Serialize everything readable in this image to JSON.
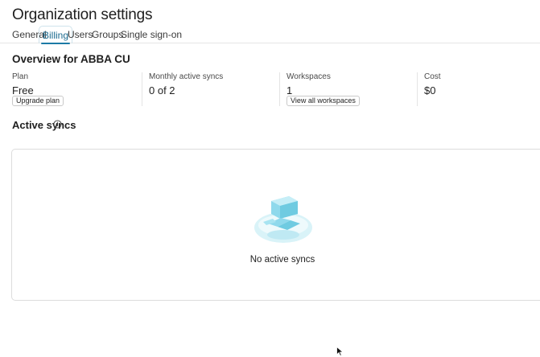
{
  "header": {
    "title": "Organization settings"
  },
  "tabs": [
    {
      "label": "General",
      "active": false
    },
    {
      "label": "Billing",
      "active": true
    },
    {
      "label": "Users",
      "active": false
    },
    {
      "label": "Groups",
      "active": false
    },
    {
      "label": "Single sign-on",
      "active": false
    }
  ],
  "overview": {
    "heading": "Overview for ABBA CU",
    "plan": {
      "label": "Plan",
      "value": "Free",
      "button": "Upgrade plan"
    },
    "syncs": {
      "label": "Monthly active syncs",
      "value": "0 of 2"
    },
    "workspaces": {
      "label": "Workspaces",
      "value": "1",
      "button": "View all workspaces"
    },
    "cost": {
      "label": "Cost",
      "value": "$0"
    }
  },
  "active_syncs": {
    "title": "Active syncs",
    "info_icon": "info-circle-icon",
    "empty_message": "No active syncs",
    "illustration": "empty-box-illustration"
  },
  "colors": {
    "accent": "#1c7aa6",
    "tab_active_text": "#1c6b8f",
    "illustration_light": "#cdeef5",
    "illustration_mid": "#8fd9ec",
    "border": "#dcdcdc"
  }
}
